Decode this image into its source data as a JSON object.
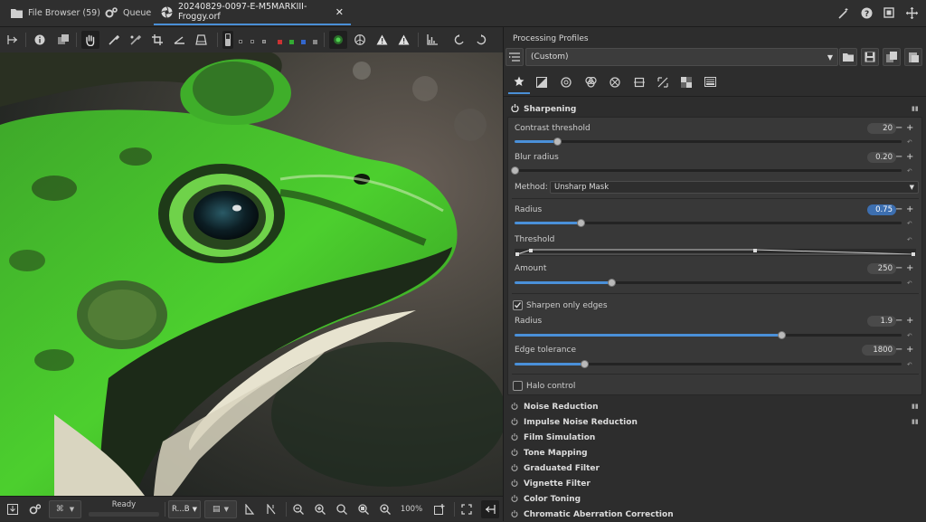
{
  "tabs": [
    {
      "label": "File Browser (59)",
      "icon": "folder-icon"
    },
    {
      "label": "Queue",
      "icon": "gears-icon"
    },
    {
      "label": "20240829-0097-E-M5MARKIII-Froggy.orf",
      "icon": "aperture-icon"
    }
  ],
  "panel": {
    "title": "Processing Profiles",
    "profile": "(Custom)"
  },
  "sharpening": {
    "title": "Sharpening",
    "contrast_threshold": {
      "label": "Contrast threshold",
      "value": "20",
      "level": 0.11
    },
    "blur_radius": {
      "label": "Blur radius",
      "value": "0.20",
      "level": 0.0
    },
    "method": {
      "label": "Method:",
      "value": "Unsharp Mask"
    },
    "radius": {
      "label": "Radius",
      "value": "0.75",
      "level": 0.17
    },
    "threshold": {
      "label": "Threshold"
    },
    "amount": {
      "label": "Amount",
      "value": "250",
      "level": 0.25
    },
    "sharpen_only_edges": {
      "label": "Sharpen only edges",
      "checked": true
    },
    "edges_radius": {
      "label": "Radius",
      "value": "1.9",
      "level": 0.69
    },
    "edge_tolerance": {
      "label": "Edge tolerance",
      "value": "1800",
      "level": 0.18
    },
    "halo_control": {
      "label": "Halo control",
      "checked": false
    }
  },
  "collapsed_sections": [
    "Noise Reduction",
    "Impulse Noise Reduction",
    "Film Simulation",
    "Tone Mapping",
    "Graduated Filter",
    "Vignette Filter",
    "Color Toning",
    "Chromatic Aberration Correction"
  ],
  "bottombar": {
    "status": "Ready",
    "channel": "R...B",
    "zoom": "100%"
  },
  "colors": {
    "accent": "#4a90d9",
    "background": "#2d2d2d"
  }
}
